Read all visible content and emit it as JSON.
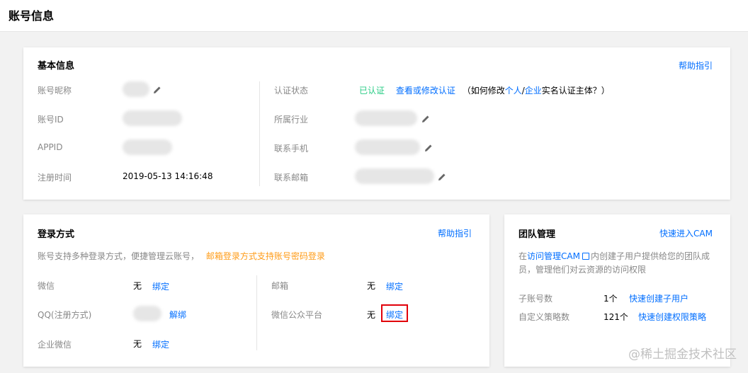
{
  "page": {
    "title": "账号信息"
  },
  "basic": {
    "title": "基本信息",
    "help": "帮助指引",
    "nickname_label": "账号昵称",
    "id_label": "账号ID",
    "appid_label": "APPID",
    "register_label": "注册时间",
    "register_value": "2019-05-13 14:16:48",
    "auth_label": "认证状态",
    "auth_status": "已认证",
    "auth_link": "查看或修改认证",
    "auth_hint_prefix": "（如何修改",
    "auth_hint_personal": "个人",
    "auth_hint_slash": "/",
    "auth_hint_enterprise": "企业",
    "auth_hint_suffix": "实名认证主体？）",
    "industry_label": "所属行业",
    "phone_label": "联系手机",
    "email_label": "联系邮箱"
  },
  "login": {
    "title": "登录方式",
    "help": "帮助指引",
    "desc": "账号支持多种登录方式，便捷管理云账号，",
    "desc_highlight": "邮箱登录方式支持账号密码登录",
    "rows_left": [
      {
        "label": "微信",
        "value": "无",
        "action": "绑定"
      },
      {
        "label": "QQ(注册方式)",
        "action": "解绑"
      },
      {
        "label": "企业微信",
        "value": "无",
        "action": "绑定"
      }
    ],
    "rows_right": [
      {
        "label": "邮箱",
        "value": "无",
        "action": "绑定"
      },
      {
        "label": "微信公众平台",
        "value": "无",
        "action": "绑定"
      }
    ]
  },
  "team": {
    "title": "团队管理",
    "quick_link": "快速进入CAM",
    "desc_prefix": "在",
    "desc_link": "访问管理CAM",
    "desc_suffix_1": "内创建子用户提供给您的团队成",
    "desc_line2": "员，管理他们对云资源的访问权限",
    "sub_label": "子账号数",
    "sub_value": "1个",
    "sub_action": "快速创建子用户",
    "policy_label": "自定义策略数",
    "policy_value": "121个",
    "policy_action": "快速创建权限策略"
  },
  "watermark": "@稀土掘金技术社区",
  "colors": {
    "link": "#006eff",
    "success": "#29cc85",
    "warning": "#ff9c19",
    "highlight_box": "#e1000a"
  }
}
